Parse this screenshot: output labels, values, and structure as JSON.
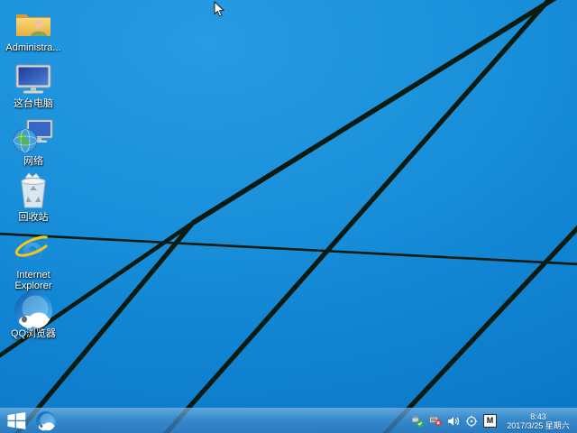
{
  "desktop": {
    "icons": [
      {
        "id": "administrator-folder",
        "label": "Administra..."
      },
      {
        "id": "this-pc",
        "label": "这台电脑"
      },
      {
        "id": "network",
        "label": "网络"
      },
      {
        "id": "recycle-bin",
        "label": "回收站"
      },
      {
        "id": "internet-explorer",
        "label": "Internet Explorer"
      },
      {
        "id": "qq-browser",
        "label": "QQ浏览器"
      }
    ]
  },
  "taskbar": {
    "tray": {
      "icon_names": [
        "usb-safe-remove-icon",
        "network-error-icon",
        "volume-icon",
        "crosshair-icon",
        "input-method-indicator"
      ],
      "input_indicator": "M",
      "clock_time": "8:43",
      "clock_date": "2017/3/25 星期六"
    }
  },
  "colors": {
    "wallpaper_light": "#279ce4",
    "wallpaper_dark": "#0a72c2",
    "beam": "#0c1b11",
    "taskbar_blue": "#3c92d0",
    "check_green": "#3fae49",
    "error_red": "#d63b3b",
    "ie_blue": "#2b9ae0",
    "ie_gold": "#f6c51c"
  }
}
